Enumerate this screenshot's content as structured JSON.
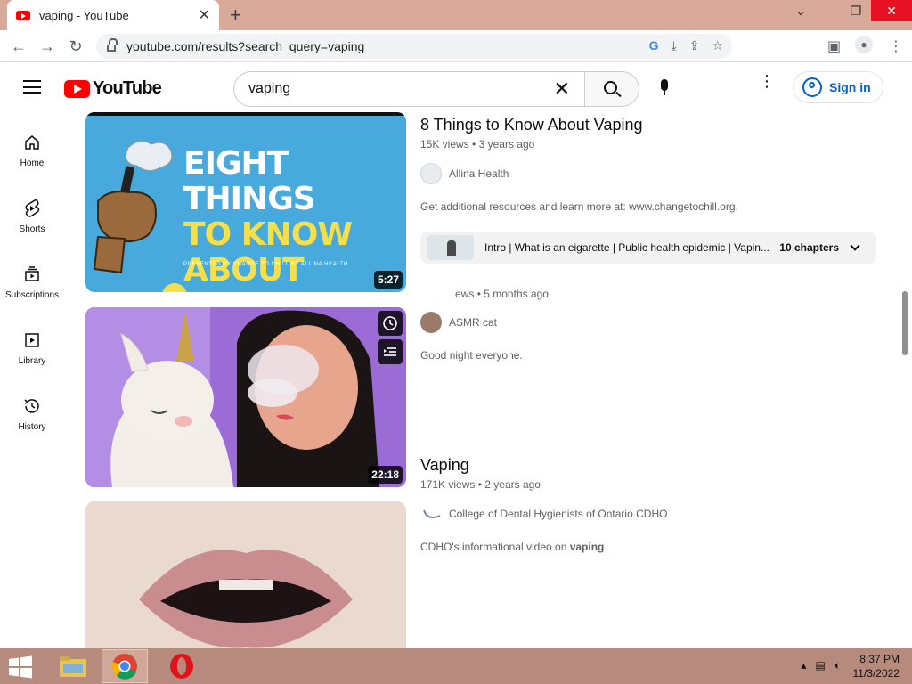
{
  "browser": {
    "tab_title": "vaping - YouTube",
    "url": "youtube.com/results?search_query=vaping"
  },
  "header": {
    "logo_text": "YouTube",
    "search_value": "vaping",
    "signin_label": "Sign in"
  },
  "guide": {
    "items": [
      {
        "label": "Home",
        "icon": "home-icon"
      },
      {
        "label": "Shorts",
        "icon": "shorts-icon"
      },
      {
        "label": "Subscriptions",
        "icon": "subscriptions-icon"
      },
      {
        "label": "Library",
        "icon": "library-icon"
      },
      {
        "label": "History",
        "icon": "history-icon"
      }
    ]
  },
  "results": [
    {
      "title": "8 Things to Know About Vaping",
      "views": "15K views",
      "age": "3 years ago",
      "channel": "Allina Health",
      "description": "Get additional resources and learn more at: www.changetochill.org.",
      "duration": "5:27",
      "thumb_line1": "EIGHT THINGS",
      "thumb_line2": "TO KNOW",
      "thumb_line3": "ABOUT VAPING",
      "thumb_caption": "PRESENTED BY CHANGE TO CHILL BY ALLINA HEALTH",
      "chapters_text": "Intro | What is an eigarette | Public health epidemic | Vapin...",
      "chapters_count": "10 chapters"
    },
    {
      "title": "",
      "views": "ews",
      "age": "5 months ago",
      "channel": "ASMR cat",
      "description": "Good night everyone.",
      "duration": "22:18"
    },
    {
      "title": "Vaping",
      "views": "171K views",
      "age": "2 years ago",
      "channel": "College of Dental Hygienists of Ontario CDHO",
      "description_prefix": "CDHO's informational video on ",
      "description_bold": "vaping",
      "description_suffix": "."
    }
  ],
  "taskbar": {
    "time": "8:37 PM",
    "date": "11/3/2022"
  },
  "colors": {
    "youtube_red": "#ff0000",
    "link_blue": "#065fd4",
    "thumb1_bg": "#47a9dc",
    "thumb1_title_white": "#ffffff",
    "thumb1_title_yellow": "#f5e04a"
  }
}
